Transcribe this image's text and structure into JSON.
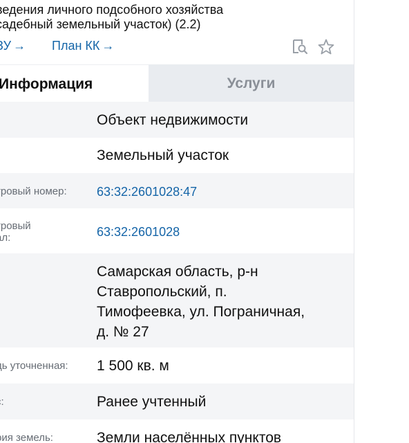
{
  "header": {
    "title_line1": "ведения личного подсобного хозяйства",
    "title_line2": "садебный земельный участок) (2.2)",
    "link_zu": "ЗУ",
    "link_plan": "План КК",
    "arrow": "→",
    "tool_icons": [
      "document-search-icon",
      "star-icon"
    ]
  },
  "tabs": {
    "info": "Информация",
    "services": "Услуги"
  },
  "rows": [
    {
      "label": "",
      "value": "Объект недвижимости"
    },
    {
      "label": "",
      "value": "Земельный участок"
    },
    {
      "label": "тровый номер:",
      "value": "63:32:2601028:47"
    },
    {
      "label_line1": "тровый",
      "label_line2": "ал:",
      "value": "63:32:2601028"
    },
    {
      "label": ":",
      "value_line1": "Самарская область, р-н",
      "value_line2": "Ставропольский, п.",
      "value_line3": "Тимофеевка, ул. Пограничная,",
      "value_line4": "д. № 27"
    },
    {
      "label": "дь уточненная:",
      "value": "1 500 кв. м"
    },
    {
      "label": "с:",
      "value": "Ранее учтенный"
    },
    {
      "label": "рия земель:",
      "value": "Земли населённых пунктов"
    }
  ],
  "colors": {
    "link": "#1565a8",
    "inactive_tab_bg": "#e9ecf0",
    "striped_row": "#f4f5f7",
    "icon_gray": "#9aa0a8"
  }
}
